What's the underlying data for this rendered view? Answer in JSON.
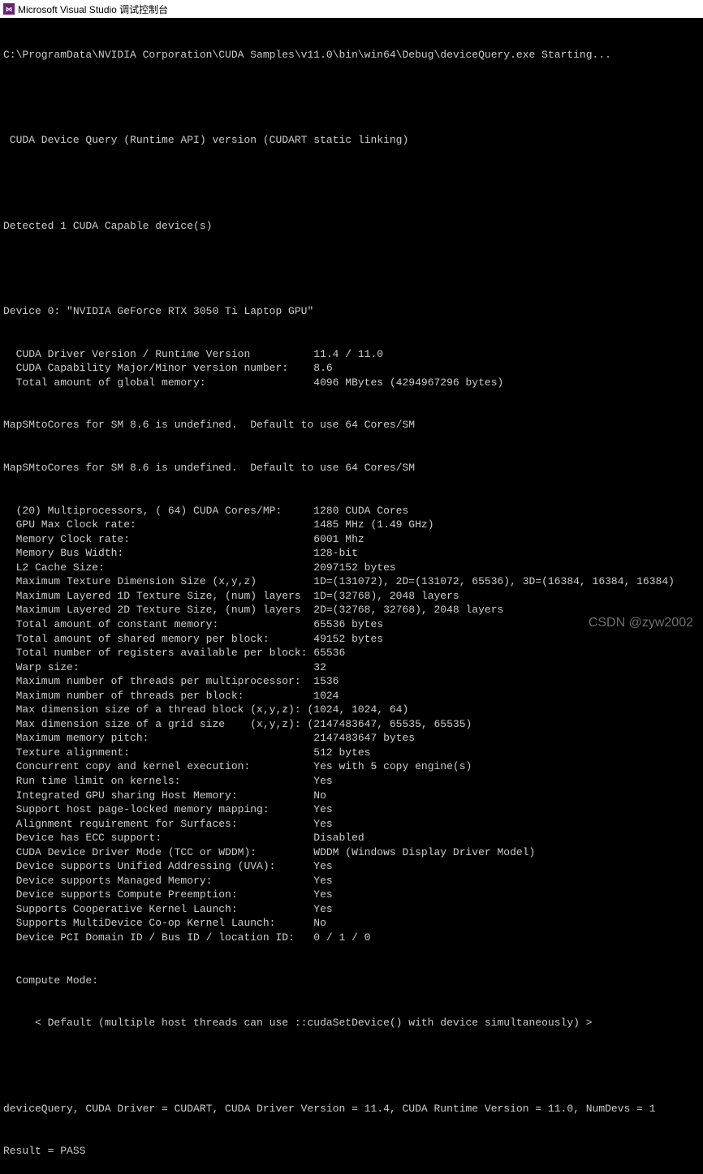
{
  "window": {
    "icon_text": "⋈",
    "title": "Microsoft Visual Studio 调试控制台"
  },
  "starting": "C:\\ProgramData\\NVIDIA Corporation\\CUDA Samples\\v11.0\\bin\\win64\\Debug\\deviceQuery.exe Starting...",
  "header": " CUDA Device Query (Runtime API) version (CUDART static linking)",
  "detected": "Detected 1 CUDA Capable device(s)",
  "device_line": "Device 0: \"NVIDIA GeForce RTX 3050 Ti Laptop GPU\"",
  "block1": [
    {
      "k": "  CUDA Driver Version / Runtime Version          ",
      "v": "11.4 / 11.0"
    },
    {
      "k": "  CUDA Capability Major/Minor version number:    ",
      "v": "8.6"
    },
    {
      "k": "  Total amount of global memory:                 ",
      "v": "4096 MBytes (4294967296 bytes)"
    }
  ],
  "warn1": "MapSMtoCores for SM 8.6 is undefined.  Default to use 64 Cores/SM",
  "warn2": "MapSMtoCores for SM 8.6 is undefined.  Default to use 64 Cores/SM",
  "block2": [
    {
      "k": "  (20) Multiprocessors, ( 64) CUDA Cores/MP:     ",
      "v": "1280 CUDA Cores"
    },
    {
      "k": "  GPU Max Clock rate:                            ",
      "v": "1485 MHz (1.49 GHz)"
    },
    {
      "k": "  Memory Clock rate:                             ",
      "v": "6001 Mhz"
    },
    {
      "k": "  Memory Bus Width:                              ",
      "v": "128-bit"
    },
    {
      "k": "  L2 Cache Size:                                 ",
      "v": "2097152 bytes"
    },
    {
      "k": "  Maximum Texture Dimension Size (x,y,z)         ",
      "v": "1D=(131072), 2D=(131072, 65536), 3D=(16384, 16384, 16384)"
    },
    {
      "k": "  Maximum Layered 1D Texture Size, (num) layers  ",
      "v": "1D=(32768), 2048 layers"
    },
    {
      "k": "  Maximum Layered 2D Texture Size, (num) layers  ",
      "v": "2D=(32768, 32768), 2048 layers"
    },
    {
      "k": "  Total amount of constant memory:               ",
      "v": "65536 bytes"
    },
    {
      "k": "  Total amount of shared memory per block:       ",
      "v": "49152 bytes"
    },
    {
      "k": "  Total number of registers available per block: ",
      "v": "65536"
    },
    {
      "k": "  Warp size:                                     ",
      "v": "32"
    },
    {
      "k": "  Maximum number of threads per multiprocessor:  ",
      "v": "1536"
    },
    {
      "k": "  Maximum number of threads per block:           ",
      "v": "1024"
    },
    {
      "k": "  Max dimension size of a thread block (x,y,z): ",
      "v": "(1024, 1024, 64)"
    },
    {
      "k": "  Max dimension size of a grid size    (x,y,z): ",
      "v": "(2147483647, 65535, 65535)"
    },
    {
      "k": "  Maximum memory pitch:                          ",
      "v": "2147483647 bytes"
    },
    {
      "k": "  Texture alignment:                             ",
      "v": "512 bytes"
    },
    {
      "k": "  Concurrent copy and kernel execution:          ",
      "v": "Yes with 5 copy engine(s)"
    },
    {
      "k": "  Run time limit on kernels:                     ",
      "v": "Yes"
    },
    {
      "k": "  Integrated GPU sharing Host Memory:            ",
      "v": "No"
    },
    {
      "k": "  Support host page-locked memory mapping:       ",
      "v": "Yes"
    },
    {
      "k": "  Alignment requirement for Surfaces:            ",
      "v": "Yes"
    },
    {
      "k": "  Device has ECC support:                        ",
      "v": "Disabled"
    },
    {
      "k": "  CUDA Device Driver Mode (TCC or WDDM):         ",
      "v": "WDDM (Windows Display Driver Model)"
    },
    {
      "k": "  Device supports Unified Addressing (UVA):      ",
      "v": "Yes"
    },
    {
      "k": "  Device supports Managed Memory:                ",
      "v": "Yes"
    },
    {
      "k": "  Device supports Compute Preemption:            ",
      "v": "Yes"
    },
    {
      "k": "  Supports Cooperative Kernel Launch:            ",
      "v": "Yes"
    },
    {
      "k": "  Supports MultiDevice Co-op Kernel Launch:      ",
      "v": "No"
    },
    {
      "k": "  Device PCI Domain ID / Bus ID / location ID:   ",
      "v": "0 / 1 / 0"
    }
  ],
  "compute_mode_label": "  Compute Mode:",
  "compute_mode_value": "     < Default (multiple host threads can use ::cudaSetDevice() with device simultaneously) >",
  "summary": "deviceQuery, CUDA Driver = CUDART, CUDA Driver Version = 11.4, CUDA Runtime Version = 11.0, NumDevs = 1",
  "result": "Result = PASS",
  "watermark": "CSDN @zyw2002"
}
